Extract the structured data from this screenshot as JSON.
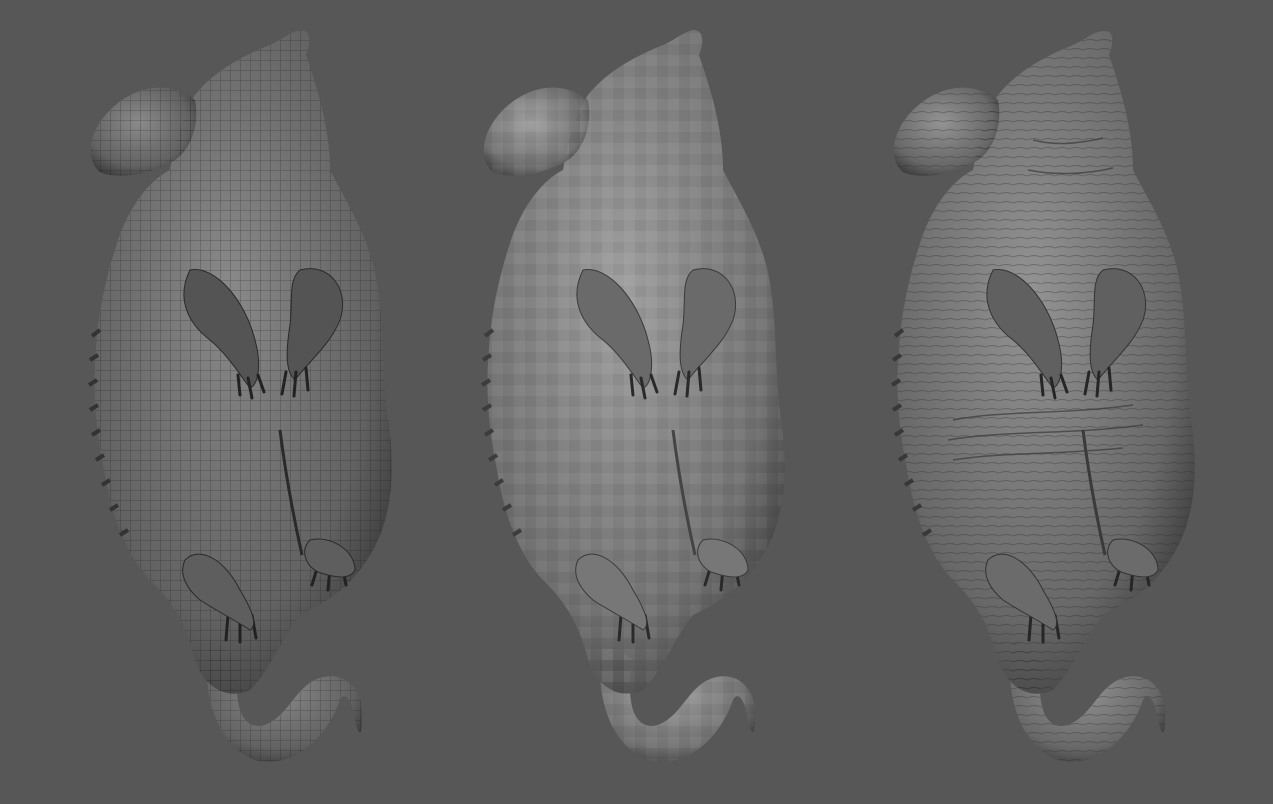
{
  "scene": {
    "background_color": "#575757",
    "panels": [
      {
        "id": "panel-a",
        "variant": "wireframe-mesh",
        "base_color": "#6d6d6d",
        "shade_color": "#2e2e2e",
        "highlight_color": "#9a9a9a"
      },
      {
        "id": "panel-b",
        "variant": "flat-faceted",
        "base_color": "#7f7f7f",
        "shade_color": "#333333",
        "highlight_color": "#b0b0b0"
      },
      {
        "id": "panel-c",
        "variant": "detailed-sculpt",
        "base_color": "#737373",
        "shade_color": "#303030",
        "highlight_color": "#a4a4a4"
      }
    ]
  }
}
